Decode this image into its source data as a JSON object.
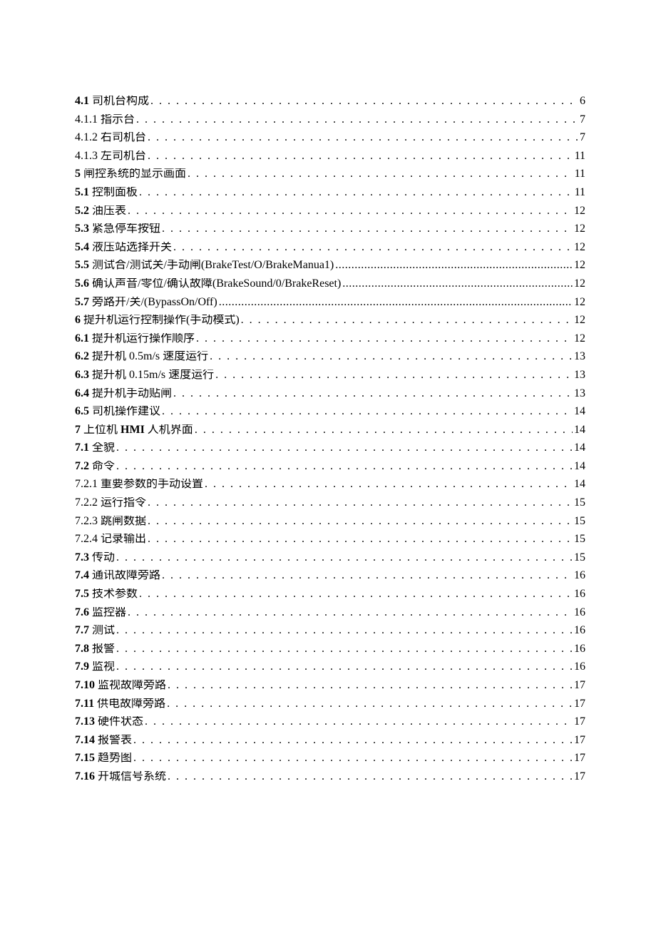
{
  "toc": [
    {
      "num": "4.1",
      "title": "司机台构成",
      "page": "6",
      "numBold": true,
      "titleBold": false,
      "dotsTight": false
    },
    {
      "num": "4.1.1",
      "title": "指示台",
      "page": "7",
      "numBold": false,
      "titleBold": false,
      "dotsTight": false
    },
    {
      "num": "4.1.2",
      "title": "右司机台",
      "page": "7",
      "numBold": false,
      "titleBold": false,
      "dotsTight": false
    },
    {
      "num": "4.1.3",
      "title": "左司机台",
      "page": "11",
      "numBold": false,
      "titleBold": false,
      "dotsTight": false
    },
    {
      "num": "5",
      "title": "闸控系统的显示画面",
      "page": "11",
      "numBold": true,
      "titleBold": false,
      "dotsTight": false,
      "noSpaceAfterNum": true
    },
    {
      "num": "5.1",
      "title": "控制面板",
      "page": "11",
      "numBold": true,
      "titleBold": false,
      "dotsTight": false
    },
    {
      "num": "5.2",
      "title": "油压表",
      "page": "12",
      "numBold": true,
      "titleBold": false,
      "dotsTight": false
    },
    {
      "num": "5.3",
      "title": "紧急停车按钮",
      "page": "12",
      "numBold": true,
      "titleBold": false,
      "dotsTight": false
    },
    {
      "num": "5.4",
      "title": "液压站选择开关",
      "page": "12",
      "numBold": true,
      "titleBold": false,
      "dotsTight": false
    },
    {
      "num": "5.5",
      "title": "测试合/测试关/手动闸(BrakeTest/O/BrakeManua1)",
      "page": "12",
      "numBold": true,
      "titleBold": false,
      "dotsTight": true
    },
    {
      "num": "5.6",
      "title": "确认声音/零位/确认故障(BrakeSound/0/BrakeReset)",
      "page": "12",
      "numBold": true,
      "titleBold": false,
      "dotsTight": true
    },
    {
      "num": "5.7",
      "title": "旁路开/关/(BypassOn/Off)",
      "page": "12",
      "numBold": true,
      "titleBold": false,
      "dotsTight": true
    },
    {
      "num": "6",
      "title": "提升机运行控制操作(手动模式)",
      "page": "12",
      "numBold": true,
      "titleBold": false,
      "dotsTight": false,
      "noSpaceAfterNum": true
    },
    {
      "num": "6.1",
      "title": "提升机运行操作顺序",
      "page": "12",
      "numBold": true,
      "titleBold": false,
      "dotsTight": false
    },
    {
      "num": "6.2",
      "title": "提升机 0.5m/s 速度运行",
      "page": "13",
      "numBold": true,
      "titleBold": false,
      "dotsTight": false
    },
    {
      "num": "6.3",
      "title": "提升机 0.15m/s 速度运行",
      "page": "13",
      "numBold": true,
      "titleBold": false,
      "dotsTight": false
    },
    {
      "num": "6.4",
      "title": "提升机手动贴闸",
      "page": "13",
      "numBold": true,
      "titleBold": false,
      "dotsTight": false
    },
    {
      "num": "6.5",
      "title": "司机操作建议",
      "page": "14",
      "numBold": true,
      "titleBold": false,
      "dotsTight": false
    },
    {
      "num": "7",
      "title": "上位机 HMI 人机界面",
      "page": "14",
      "numBold": true,
      "titleBold": false,
      "dotsTight": false,
      "noSpaceAfterNum": true,
      "mixedTitle": true
    },
    {
      "num": "7.1",
      "title": "全貌",
      "page": "14",
      "numBold": true,
      "titleBold": false,
      "dotsTight": false
    },
    {
      "num": "7.2",
      "title": "命令",
      "page": "14",
      "numBold": true,
      "titleBold": false,
      "dotsTight": false
    },
    {
      "num": "7.2.1",
      "title": "重要参数的手动设置",
      "page": "14",
      "numBold": false,
      "titleBold": false,
      "dotsTight": false
    },
    {
      "num": "7.2.2",
      "title": "运行指令",
      "page": "15",
      "numBold": false,
      "titleBold": false,
      "dotsTight": false
    },
    {
      "num": "7.2.3",
      "title": "跳闸数据",
      "page": "15",
      "numBold": false,
      "titleBold": false,
      "dotsTight": false
    },
    {
      "num": "7.2.4",
      "title": "记录输出",
      "page": "15",
      "numBold": false,
      "titleBold": false,
      "dotsTight": false
    },
    {
      "num": "7.3",
      "title": "传动",
      "page": "15",
      "numBold": true,
      "titleBold": false,
      "dotsTight": false
    },
    {
      "num": "7.4",
      "title": "通讯故障旁路",
      "page": "16",
      "numBold": true,
      "titleBold": false,
      "dotsTight": false
    },
    {
      "num": "7.5",
      "title": "技术参数",
      "page": "16",
      "numBold": true,
      "titleBold": false,
      "dotsTight": false
    },
    {
      "num": "7.6",
      "title": "监控器",
      "page": "16",
      "numBold": true,
      "titleBold": false,
      "dotsTight": false
    },
    {
      "num": "7.7",
      "title": "测试",
      "page": "16",
      "numBold": true,
      "titleBold": false,
      "dotsTight": false
    },
    {
      "num": "7.8",
      "title": "报警",
      "page": "16",
      "numBold": true,
      "titleBold": false,
      "dotsTight": false
    },
    {
      "num": "7.9",
      "title": "监视",
      "page": "16",
      "numBold": true,
      "titleBold": false,
      "dotsTight": false
    },
    {
      "num": "7.10",
      "title": "监视故障旁路",
      "page": "17",
      "numBold": true,
      "titleBold": false,
      "dotsTight": false
    },
    {
      "num": "7.11",
      "title": "供电故障旁路",
      "page": "17",
      "numBold": true,
      "titleBold": false,
      "dotsTight": false
    },
    {
      "num": "7.13",
      "title": "硬件状态",
      "page": "17",
      "numBold": true,
      "titleBold": false,
      "dotsTight": false
    },
    {
      "num": "7.14",
      "title": "报警表",
      "page": "17",
      "numBold": true,
      "titleBold": false,
      "dotsTight": false
    },
    {
      "num": "7.15",
      "title": "趋势图",
      "page": "17",
      "numBold": true,
      "titleBold": false,
      "dotsTight": false
    },
    {
      "num": "7.16",
      "title": "开城信号系统",
      "page": "17",
      "numBold": true,
      "titleBold": false,
      "dotsTight": false
    }
  ]
}
